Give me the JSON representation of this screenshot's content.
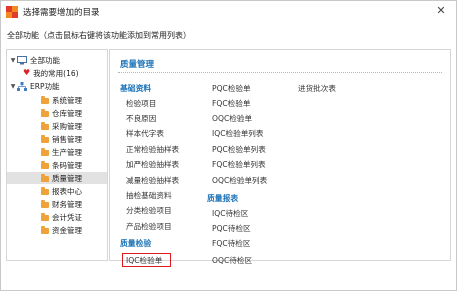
{
  "window": {
    "title": "选择需要增加的目录",
    "close_glyph": "✕",
    "subheader": "全部功能（点击鼠标右键将该功能添加到常用列表）"
  },
  "tree": {
    "items": [
      {
        "label": "全部功能",
        "icon": "monitor-icon"
      },
      {
        "label": "我的常用(16)",
        "icon": "heart-icon"
      },
      {
        "label": "ERP功能",
        "icon": "sitemap-icon"
      },
      {
        "label": "系统管理",
        "icon": "folder-icon"
      },
      {
        "label": "仓库管理",
        "icon": "folder-icon"
      },
      {
        "label": "采购管理",
        "icon": "folder-icon"
      },
      {
        "label": "销售管理",
        "icon": "folder-icon"
      },
      {
        "label": "生产管理",
        "icon": "folder-icon"
      },
      {
        "label": "条码管理",
        "icon": "folder-icon"
      },
      {
        "label": "质量管理",
        "icon": "folder-icon"
      },
      {
        "label": "报表中心",
        "icon": "folder-icon"
      },
      {
        "label": "财务管理",
        "icon": "folder-icon"
      },
      {
        "label": "会计凭证",
        "icon": "folder-icon"
      },
      {
        "label": "资金管理",
        "icon": "folder-icon"
      }
    ],
    "selected": "质量管理"
  },
  "content": {
    "title": "质量管理",
    "col1_basic_head": "基础资料",
    "col1_basic": [
      "检验项目",
      "不良原因",
      "样本代字表",
      "正常检验抽样表",
      "加严检验抽样表",
      "减量检验抽样表",
      "抽检基础资料",
      "分类检验项目",
      "产品检验项目"
    ],
    "col1_qc_head": "质量检验",
    "col1_qc": [
      "IQC检验单"
    ],
    "col2_top": [
      "PQC检验单",
      "FQC检验单",
      "OQC检验单",
      "IQC检验单列表",
      "PQC检验单列表",
      "FQC检验单列表",
      "OQC检验单列表"
    ],
    "col2_report_head": "质量报表",
    "col2_report": [
      "IQC待检区",
      "PQC待检区",
      "FQC待检区",
      "OQC待检区"
    ],
    "col3": [
      "进货批次表"
    ]
  },
  "colors": {
    "accent": "#1e73b8",
    "highlight": "#e0191f",
    "folder": "#f0a23a",
    "selected_bg": "#e2e2e2"
  }
}
